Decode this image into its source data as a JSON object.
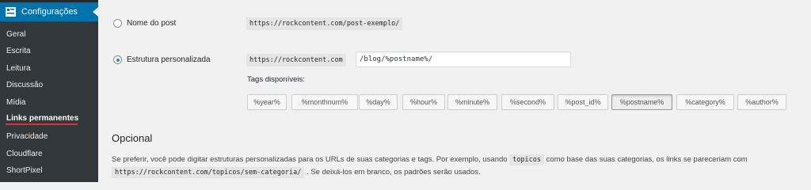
{
  "sidebar": {
    "header_label": "Configurações",
    "items": [
      {
        "label": "Geral"
      },
      {
        "label": "Escrita"
      },
      {
        "label": "Leitura"
      },
      {
        "label": "Discussão"
      },
      {
        "label": "Mídia"
      },
      {
        "label": "Links permanentes",
        "current": true
      },
      {
        "label": "Privacidade"
      },
      {
        "label": "Cloudflare"
      },
      {
        "label": "ShortPixel"
      }
    ],
    "colors": {
      "bg": "#23282d",
      "header_bg": "#0073aa",
      "underline": "#dc3232"
    }
  },
  "options": {
    "post_name": {
      "label": "Nome do post",
      "example": "https://rockcontent.com/post-exemplo/",
      "checked": false
    },
    "custom": {
      "label": "Estrutura personalizada",
      "base": "https://rockcontent.com",
      "value": "/blog/%postname%/",
      "checked": true
    }
  },
  "tags": {
    "title": "Tags disponíveis:",
    "items": [
      "%year%",
      "%monthnum%",
      "%day%",
      "%hour%",
      "%minute%",
      "%second%",
      "%post_id%",
      "%postname%",
      "%category%",
      "%author%"
    ],
    "active": "%postname%"
  },
  "optional": {
    "heading": "Opcional",
    "line1_before": "Se preferir, você pode digitar estruturas personalizadas para os URLs de suas categorias e tags. Por exemplo, usando",
    "line1_code": "topicos",
    "line1_after": "como base das suas categorias, os links se pareceriam com",
    "line2_code": "https://rockcontent.com/topicos/sem-categoria/",
    "line2_after": ". Se deixá-los em branco, os padrões serão usados."
  }
}
